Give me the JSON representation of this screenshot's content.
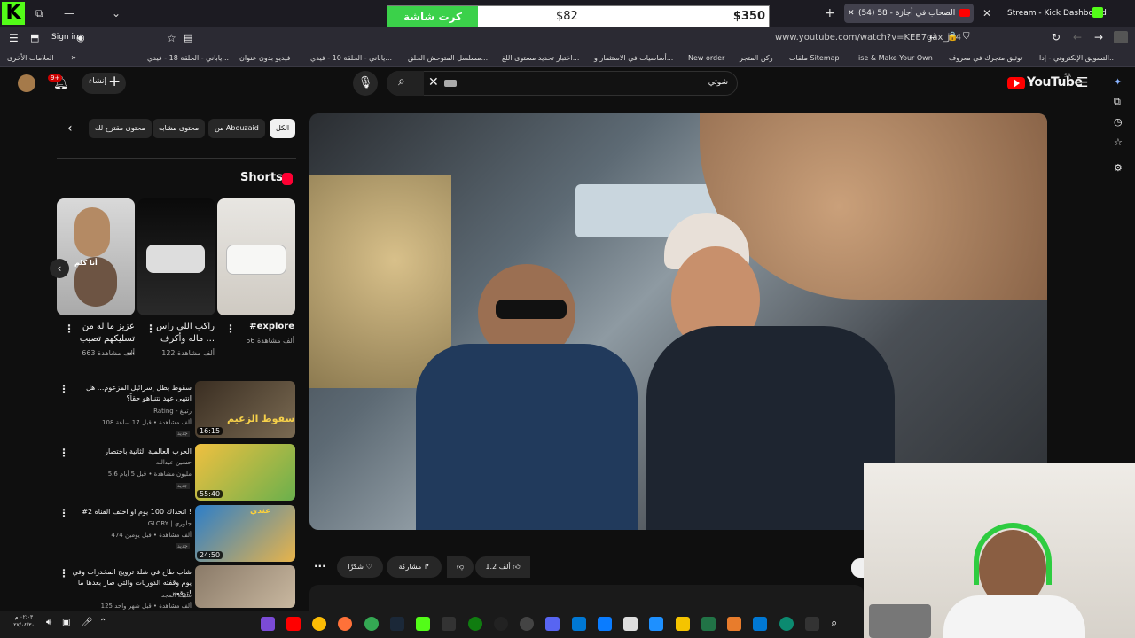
{
  "browser": {
    "price_widget": {
      "green_label": "كرت شاشة",
      "middle_value": "$82",
      "right_value": "$350"
    },
    "active_tab_title": "(54) 58 - الصحاب في أجازة",
    "tab2_title": "Stream - Kick Dashboard",
    "url": "www.youtube.com/watch?v=KEE7gax_jS4",
    "sign_in": "Sign in",
    "bookmarks": [
      "التسويق الإلكتروني - إدا...",
      "توثيق متجرك في معروف",
      "ise & Make Your Own",
      "ملفات Sitemap",
      "ركن المتجر",
      "New order",
      "أساسيات في الاستثمار و...",
      "اختبار تحديد مستوى اللغ...",
      "مسلسل المتوحش الحلق...",
      "ياباني - الحلقة 10 - فيدي...",
      "فيديو بدون عنوان",
      "ياباني - الحلقة 18 - فيدي..."
    ],
    "other_bookmarks": "العلامات الأخرى"
  },
  "youtube": {
    "logo": "YouTube",
    "logo_region": "SA",
    "search_value": "شوتي",
    "create_label": "إنشاء",
    "notification_count": "9+",
    "chips": [
      "الكل",
      "من Abouzaid",
      "محتوى مشابه",
      "محتوى مقترح لك"
    ],
    "shorts_heading": "Shorts",
    "shorts": [
      {
        "title": "#explore",
        "views": "56 ألف مشاهدة"
      },
      {
        "title": "راكب اللي راس ماله وأكرف ...",
        "views": "122 ألف مشاهدة"
      },
      {
        "title": "عزيز ما له من تسليكهم تصيب ...",
        "views": "663 ألف مشاهدة"
      }
    ],
    "short3_overlay": "أنا كلم",
    "recommended": [
      {
        "title": "سقوط بطل إسرائيل المزعوم... هل انتهى عهد نتنياهو حقاً؟",
        "channel": "Rating - رتينغ",
        "meta": "108 ألف مشاهدة • قبل 17 ساعة",
        "badge": "جديد",
        "duration": "16:15",
        "thumb_text": "سقوط الزعيم"
      },
      {
        "title": "الحرب العالمية الثانية باختصار",
        "channel": "حسين عبدالله",
        "meta": "5.6 مليون مشاهدة • قبل 5 أيام",
        "badge": "جديد",
        "duration": "55:40",
        "thumb_text": ""
      },
      {
        "title": "#2 اتحداك 100 يوم او اختف القناة !",
        "channel": "GLORY | جلوري",
        "meta": "474 ألف مشاهدة • قبل يومين",
        "badge": "جديد",
        "duration": "24:50",
        "thumb_text": "عندي"
      },
      {
        "title": "شاب طاح في شلة ترويج المخدرات وفي يوم وقفته الدوريات والتي صار بعدها ما توقعه!",
        "channel": "شبكة المجد",
        "meta": "125 ألف مشاهدة • قبل شهر واحد",
        "badge": "",
        "duration": "",
        "thumb_text": ""
      }
    ],
    "actions": {
      "likes": "1.2 ألف",
      "share": "مشاركة",
      "thanks": "شكرًا"
    }
  },
  "taskbar": {
    "clock_time": "٠٢:٠٣ م",
    "clock_date": "٢٧/٠٤/٣٠"
  },
  "colors": {
    "kick_green": "#53fc18",
    "yt_red": "#ff0000",
    "bg": "#0f0f0f"
  }
}
